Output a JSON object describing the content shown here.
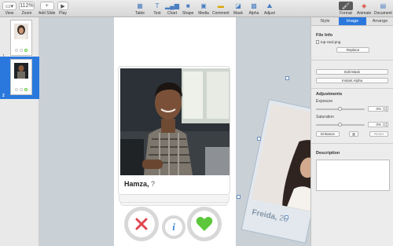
{
  "toolbar": {
    "view_label": "View",
    "zoom_value": "112%",
    "zoom_label": "Zoom",
    "add_slide_label": "Add Slide",
    "play_label": "Play",
    "insert_items": [
      {
        "label": "Table",
        "icon": "table-icon"
      },
      {
        "label": "Text",
        "icon": "text-icon"
      },
      {
        "label": "Chart",
        "icon": "chart-icon"
      },
      {
        "label": "Shape",
        "icon": "shape-icon"
      },
      {
        "label": "Media",
        "icon": "media-icon"
      },
      {
        "label": "Comment",
        "icon": "comment-icon"
      },
      {
        "label": "Mask",
        "icon": "mask-icon"
      },
      {
        "label": "Alpha",
        "icon": "alpha-icon"
      },
      {
        "label": "Adjust",
        "icon": "adjust-icon"
      }
    ],
    "right_items": [
      {
        "label": "Format",
        "icon": "format-icon"
      },
      {
        "label": "Animate",
        "icon": "animate-icon"
      },
      {
        "label": "Document",
        "icon": "document-icon"
      }
    ]
  },
  "navigator": {
    "slides": [
      {
        "number": "1",
        "selected": false
      },
      {
        "number": "2",
        "selected": true
      }
    ]
  },
  "slide": {
    "card_name": "Hamza,",
    "card_age": "?",
    "dragged_card_name": "Freida,",
    "dragged_card_age": "20"
  },
  "inspector": {
    "tabs": [
      "Style",
      "Image",
      "Arrange"
    ],
    "active_tab": "Image",
    "file_info_title": "File Info",
    "file_name": "top-card.png",
    "replace_button": "Replace",
    "edit_mask_button": "Edit Mask",
    "instant_alpha_button": "Instant Alpha",
    "adjustments_title": "Adjustments",
    "exposure_label": "Exposure",
    "exposure_value": "0%",
    "exposure_level": 0.5,
    "saturation_label": "Saturation",
    "saturation_value": "0%",
    "saturation_level": 0.5,
    "enhance_button": "Enhance",
    "reset_button": "Reset",
    "description_title": "Description"
  },
  "colors": {
    "accent": "#2a78dd",
    "reject": "#e0454f",
    "like": "#5cc73a",
    "info": "#3a86d8"
  }
}
